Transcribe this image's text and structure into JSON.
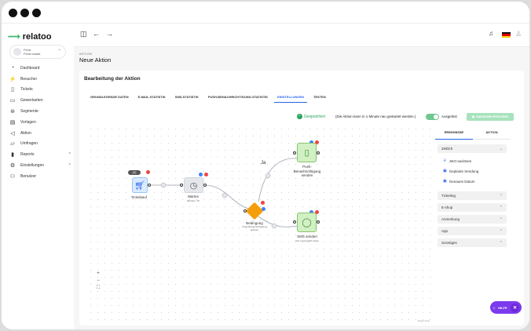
{
  "app": {
    "name": "relatoo"
  },
  "store": {
    "name": "Fena",
    "sub": "Fena madut"
  },
  "nav": [
    {
      "label": "Dashboard",
      "icon": "dashboard-icon"
    },
    {
      "label": "Besucher",
      "icon": "visitors-icon"
    },
    {
      "label": "Tickets",
      "icon": "ticket-icon"
    },
    {
      "label": "Gewerkarten",
      "icon": "card-icon"
    },
    {
      "label": "Segmente",
      "icon": "segments-icon"
    },
    {
      "label": "Vorlagen",
      "icon": "templates-icon"
    },
    {
      "label": "Aktion",
      "icon": "action-icon"
    },
    {
      "label": "Umfragen",
      "icon": "survey-icon"
    },
    {
      "label": "Reports",
      "icon": "reports-icon",
      "chevron": "^"
    },
    {
      "label": "Einstellungen",
      "icon": "settings-icon",
      "chevron": "^"
    },
    {
      "label": "Benutzer",
      "icon": "users-icon"
    }
  ],
  "header": {
    "breadcrumb": "AKTION",
    "title": "Neue Aktion"
  },
  "card": {
    "title": "Bearbeitung der Aktion"
  },
  "tabs": [
    {
      "label": "GRUNDLEGENDE DATEN"
    },
    {
      "label": "E-MAIL-STATISTIK"
    },
    {
      "label": "SMS-STATISTIK"
    },
    {
      "label": "PUSH-BENACHRICHTIGUNG-STATISTIK"
    },
    {
      "label": "EINSTELLUNGEN",
      "active": true
    },
    {
      "label": "TESTEN"
    }
  ],
  "status": {
    "saved": "Gespeichert",
    "note": "(Die Aktion kann in 1 Minute neu gestartet werden.)",
    "toggle_label": "Ausgelöst",
    "save_button": "DIAGRAMM SPEICHERN"
  },
  "panel": {
    "tabs": [
      "EREIGNISSE",
      "AKTION"
    ],
    "sections": [
      {
        "label": "Zeitlich",
        "open": true,
        "items": [
          "Jetzt auslösen",
          "Geplante Sendung",
          "Genaues Datum"
        ]
      },
      {
        "label": "Ticketing"
      },
      {
        "label": "E-shop"
      },
      {
        "label": "Anmerkung"
      },
      {
        "label": "App"
      },
      {
        "label": "Sonstiges"
      }
    ]
  },
  "flow": {
    "trigger": {
      "label": "Ticketkauf",
      "badge": "(0)"
    },
    "wait": {
      "label": "Warten",
      "sub": "Minuten: 15"
    },
    "condition": {
      "label": "Bedingung",
      "sub": "Push-Benachrichtigung gelesen"
    },
    "push": {
      "label": "Push-Benachrichtigung senden",
      "branch": "Ja"
    },
    "sms": {
      "label": "SMS senden",
      "sub": "Der Lesezugriff: keine"
    }
  },
  "zoom": {
    "plus": "+",
    "minus": "−",
    "fit": "⛶"
  },
  "attribution": "React Flow",
  "help": {
    "label": "HILFE"
  },
  "colors": {
    "accent": "#2563eb",
    "green": "#22a35a",
    "purple": "#7c3aed",
    "trigger": "#dbeafe",
    "condition": "#f59e0b",
    "action": "#d1f0c4"
  }
}
